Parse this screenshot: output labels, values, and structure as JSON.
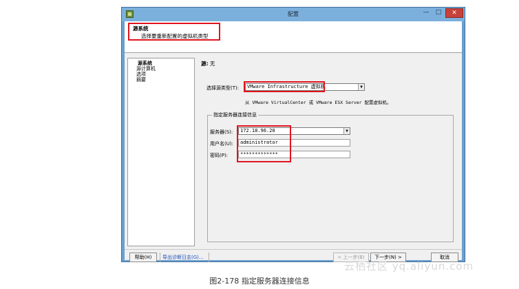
{
  "window": {
    "title": "配置",
    "min_glyph": "—",
    "max_glyph": "□",
    "close_glyph": "✕"
  },
  "header": {
    "title": "源系统",
    "subtitle": "选择要重新配置的虚拟机类型"
  },
  "nav": {
    "items": [
      "源系统",
      "源计算机",
      "选项",
      "摘要"
    ]
  },
  "main": {
    "source_label": "源:",
    "source_value": "无",
    "source_type_label": "选择源类型(T):",
    "source_type_value": "VMware Infrastructure 虚拟机",
    "source_type_note": "从 VMware VirtualCenter 或 VMware ESX Server 配置虚拟机。",
    "group_title": "指定服务器连接信息",
    "server_label": "服务器(S):",
    "server_value": "172.18.96.20",
    "username_label": "用户名(U):",
    "username_value": "administrator",
    "password_label": "密码(P):",
    "password_value": "*************"
  },
  "footer": {
    "help_button": "帮助(H)",
    "export_log_link": "导出诊断日志(G)...",
    "back_button": "< 上一步(B)",
    "next_button": "下一步(N) >",
    "cancel_button": "取消"
  },
  "caption": "图2-178 指定服务器连接信息",
  "watermark": "云栖社区 yq.aliyun.com"
}
